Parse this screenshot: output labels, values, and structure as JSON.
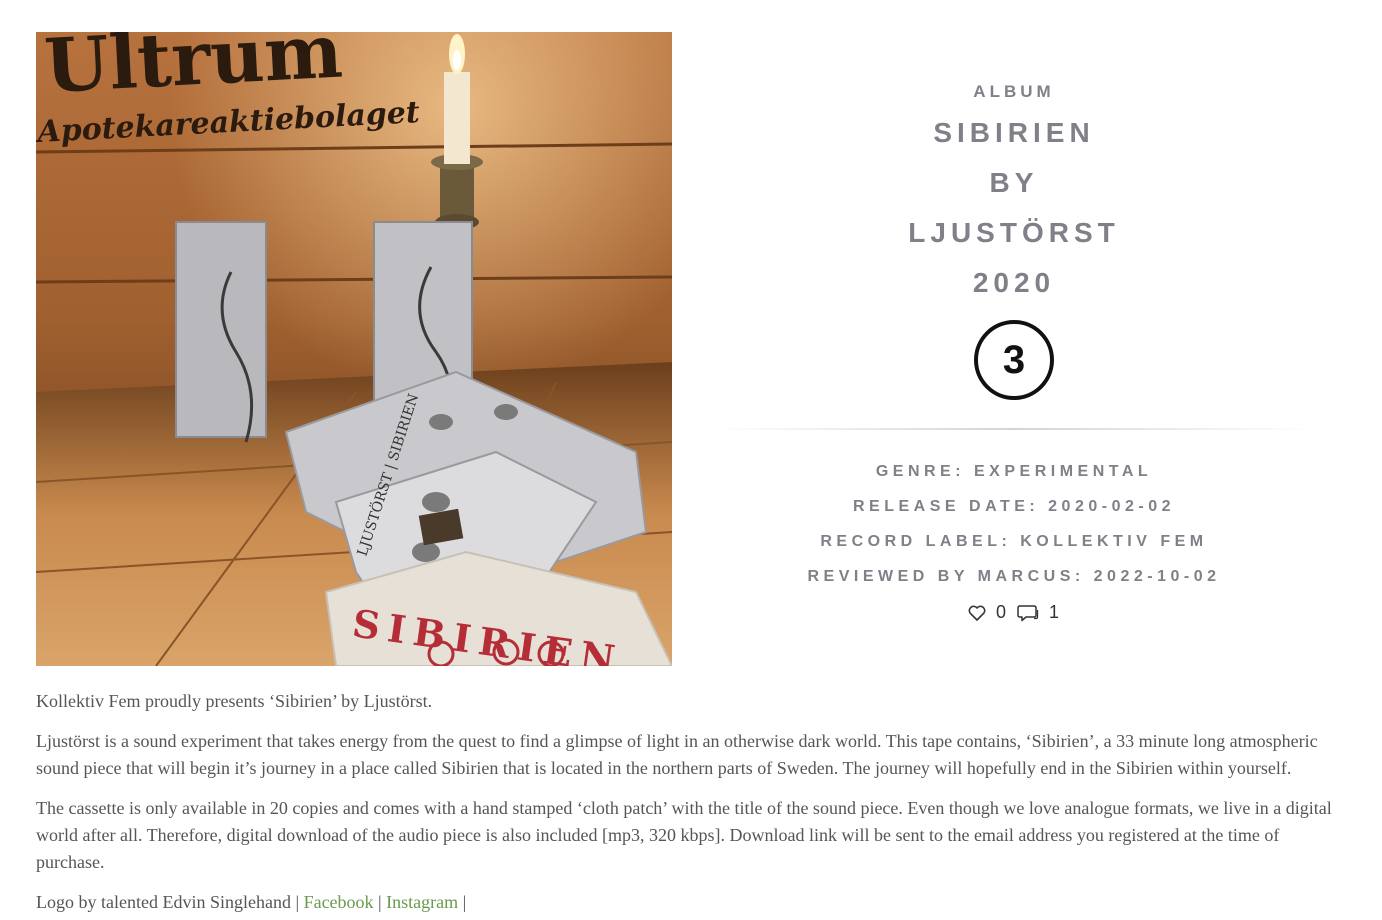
{
  "album": {
    "kind_label": "ALBUM",
    "title": "SIBIRIEN",
    "by_label": "BY",
    "artist": "LJUSTÖRST",
    "year": "2020",
    "rating": "3",
    "cover_alt": "Sibirien cassette cover photo"
  },
  "details": {
    "genre": "GENRE: EXPERIMENTAL",
    "release_date": "RELEASE DATE: 2020-02-02",
    "record_label": "RECORD LABEL: KOLLEKTIV FEM",
    "reviewed_by": "REVIEWED BY MARCUS: 2022-10-02"
  },
  "stats": {
    "likes": "0",
    "comments": "1"
  },
  "description": {
    "p1": "Kollektiv Fem proudly presents ‘Sibirien’ by Ljustörst.",
    "p2": "Ljustörst is a sound experiment that takes energy from the quest to find a glimpse of light in an otherwise dark world. This tape contains, ‘Sibirien’, a 33 minute long atmospheric sound piece that will begin it’s journey in a place called Sibirien that is located in the northern parts of Sweden. The journey will hopefully end in the Sibirien within yourself.",
    "p3": "The cassette is only available in 20 copies and comes with a hand stamped ‘cloth patch’ with the title of the sound piece. Even though we love analogue formats, we live in a digital world after all. Therefore, digital download of the audio piece is also included [mp3, 320 kbps]. Download link will be sent to the email address you registered at the time of purchase.",
    "credit_prefix": "Logo by talented Edvin Singlehand | ",
    "link_facebook": "Facebook",
    "separator": " | ",
    "link_instagram": "Instagram",
    "trailing": " |"
  },
  "photo_text": {
    "crate_top": "Ultrum",
    "crate_sub": "Apotekareaktiebolaget",
    "patch": "SIBIRIEN",
    "tape_label": "LJUSTÖRST | SIBIRIEN"
  },
  "colors": {
    "heading": "#808089",
    "body": "#555555",
    "link": "#6a9a4e"
  },
  "icons": {
    "like": "heart-icon",
    "comment": "speech-bubble-icon"
  }
}
